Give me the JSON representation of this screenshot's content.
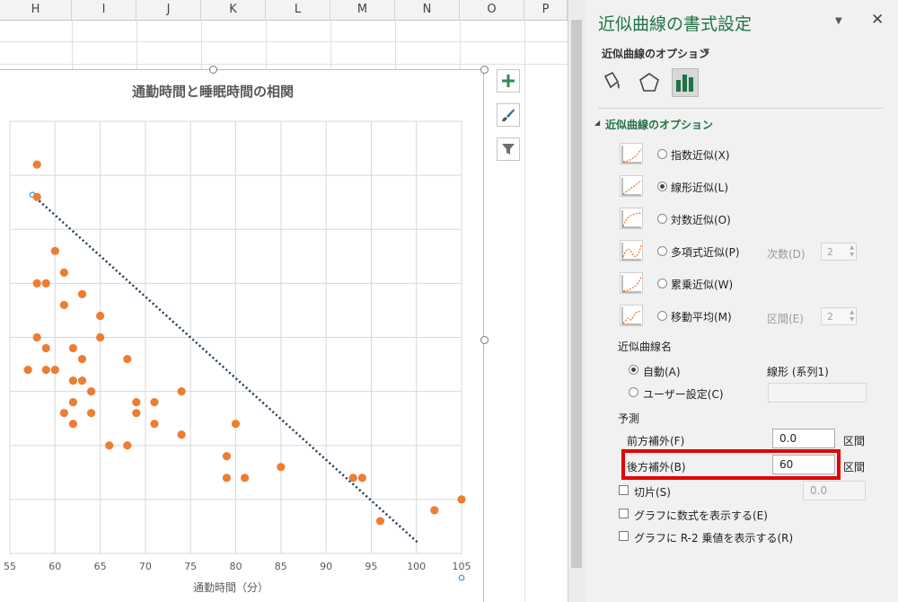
{
  "sheet": {
    "columns": [
      "H",
      "I",
      "J",
      "K",
      "L",
      "M",
      "N",
      "O",
      "P"
    ]
  },
  "chart": {
    "buttons": [
      {
        "name": "chart-elements-button",
        "icon": "plus-icon"
      },
      {
        "name": "chart-styles-button",
        "icon": "brush-icon"
      },
      {
        "name": "chart-filters-button",
        "icon": "funnel-icon"
      }
    ]
  },
  "chart_data": {
    "type": "scatter",
    "title": "通勤時間と睡眠時間の相関",
    "xlabel": "通勤時間（分）",
    "ylabel": "",
    "xlim": [
      55,
      105
    ],
    "ylim": [
      0,
      8
    ],
    "x_ticks": [
      "55",
      "60",
      "65",
      "70",
      "75",
      "80",
      "85",
      "90",
      "95",
      "100",
      "105"
    ],
    "grid": true,
    "marker_color": "#ED7D31",
    "trendline": {
      "type": "linear",
      "color": "#1F3864",
      "style": "dotted",
      "from": [
        57.5,
        6.64
      ],
      "to": [
        100.3,
        0.18
      ]
    },
    "series": [
      {
        "points": [
          [
            58,
            7.2
          ],
          [
            58,
            6.6
          ],
          [
            60,
            5.6
          ],
          [
            61,
            5.2
          ],
          [
            58,
            5.0
          ],
          [
            59,
            5.0
          ],
          [
            63,
            4.8
          ],
          [
            61,
            4.6
          ],
          [
            65,
            4.4
          ],
          [
            57,
            3.4
          ],
          [
            58,
            4.0
          ],
          [
            59,
            3.8
          ],
          [
            65,
            4.0
          ],
          [
            62,
            3.8
          ],
          [
            63,
            3.6
          ],
          [
            68,
            3.6
          ],
          [
            60,
            3.4
          ],
          [
            59,
            3.4
          ],
          [
            62,
            3.2
          ],
          [
            63,
            3.2
          ],
          [
            64,
            3.0
          ],
          [
            74,
            3.0
          ],
          [
            62,
            2.8
          ],
          [
            69,
            2.8
          ],
          [
            71,
            2.8
          ],
          [
            61,
            2.6
          ],
          [
            64,
            2.6
          ],
          [
            69,
            2.6
          ],
          [
            62,
            2.4
          ],
          [
            71,
            2.4
          ],
          [
            80,
            2.4
          ],
          [
            74,
            2.2
          ],
          [
            66,
            2.0
          ],
          [
            68,
            2.0
          ],
          [
            79,
            1.8
          ],
          [
            85,
            1.6
          ],
          [
            79,
            1.4
          ],
          [
            81,
            1.4
          ],
          [
            93,
            1.4
          ],
          [
            94,
            1.4
          ],
          [
            105,
            1.0
          ],
          [
            102,
            0.8
          ],
          [
            96,
            0.6
          ]
        ]
      }
    ]
  },
  "pane": {
    "title": "近似曲線の書式設定",
    "subtitle": "近似曲線のオプション",
    "section": "近似曲線のオプション",
    "types": [
      {
        "label": "指数近似(X)",
        "selected": false
      },
      {
        "label": "線形近似(L)",
        "selected": true
      },
      {
        "label": "対数近似(O)",
        "selected": false
      },
      {
        "label": "多項式近似(P)",
        "selected": false
      },
      {
        "label": "累乗近似(W)",
        "selected": false
      },
      {
        "label": "移動平均(M)",
        "selected": false
      }
    ],
    "order_label": "次数(D)",
    "order_value": "2",
    "period_label": "区間(E)",
    "period_value": "2",
    "trendline_name_heading": "近似曲線名",
    "auto_label": "自動(A)",
    "auto_value": "線形 (系列1)",
    "custom_label": "ユーザー設定(C)",
    "forecast_heading": "予測",
    "forward_label": "前方補外(F)",
    "forward_value": "0.0",
    "backward_label": "後方補外(B)",
    "backward_value": "60",
    "unit_label": "区間",
    "intercept_label": "切片(S)",
    "intercept_value": "0.0",
    "show_equation_label": "グラフに数式を表示する(E)",
    "show_r2_label": "グラフに R-2 乗値を表示する(R)",
    "highlight_color": "#E60000"
  }
}
